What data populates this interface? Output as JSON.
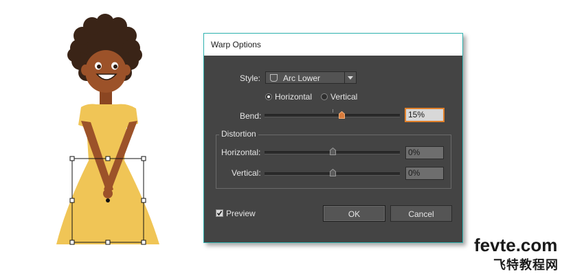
{
  "dialog": {
    "title": "Warp Options",
    "style_label": "Style:",
    "style_value": "Arc Lower",
    "orientation": {
      "horizontal_label": "Horizontal",
      "vertical_label": "Vertical",
      "selected": "horizontal"
    },
    "bend": {
      "label": "Bend:",
      "value_text": "15%",
      "value": 15
    },
    "distortion": {
      "legend": "Distortion",
      "horizontal": {
        "label": "Horizontal:",
        "value_text": "0%",
        "value": 0
      },
      "vertical": {
        "label": "Vertical:",
        "value_text": "0%",
        "value": 0
      }
    },
    "preview": {
      "label": "Preview",
      "checked": true
    },
    "buttons": {
      "ok": "OK",
      "cancel": "Cancel"
    }
  },
  "watermark": {
    "line1": "fevte.com",
    "line2": "飞特教程网"
  },
  "colors": {
    "dialog_bg": "#444444",
    "dialog_border": "#2fb3b0",
    "focus_accent": "#e0802a",
    "dress": "#f0c556",
    "skin": "#9c5229",
    "hair": "#3a2417"
  },
  "icons": {
    "style_icon": "arc-lower-shape-icon",
    "select_arrow": "chevron-down-icon",
    "preview_check": "checkmark-icon"
  }
}
